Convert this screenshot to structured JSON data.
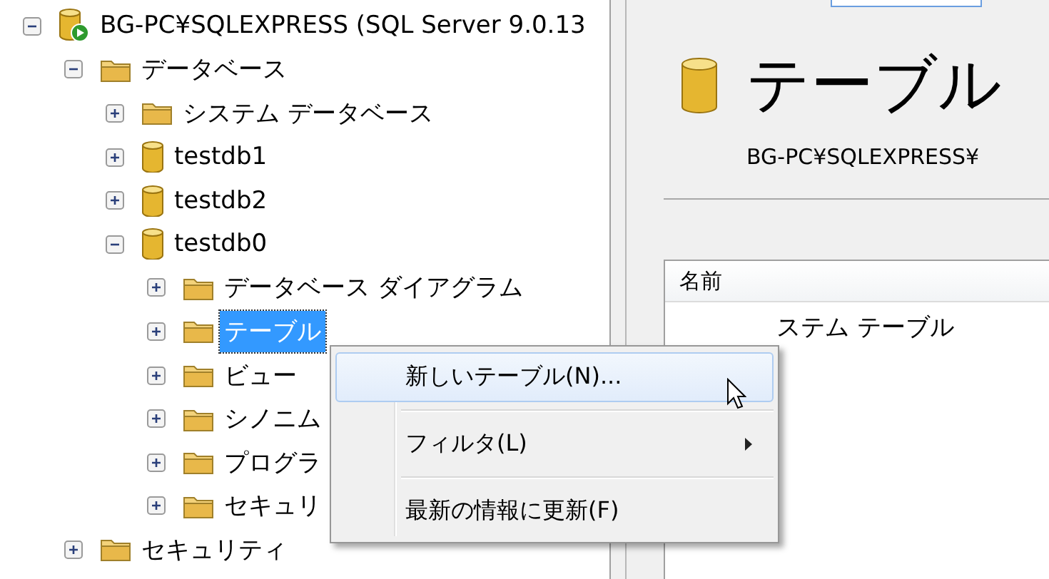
{
  "tree": [
    {
      "label": "BG-PC¥SQLEXPRESS (SQL Server 9.0.13",
      "kind": "server",
      "expanded": true,
      "selected": false,
      "children": [
        {
          "label": "データベース",
          "kind": "folder",
          "expanded": true,
          "selected": false,
          "children": [
            {
              "label": "システム データベース",
              "kind": "folder",
              "expanded": false,
              "selected": false
            },
            {
              "label": "testdb1",
              "kind": "database",
              "expanded": false,
              "selected": false
            },
            {
              "label": "testdb2",
              "kind": "database",
              "expanded": false,
              "selected": false
            },
            {
              "label": "testdb0",
              "kind": "database",
              "expanded": true,
              "selected": false,
              "children": [
                {
                  "label": "データベース ダイアグラム",
                  "kind": "folder",
                  "expanded": false,
                  "selected": false
                },
                {
                  "label": "テーブル",
                  "kind": "folder",
                  "expanded": false,
                  "selected": true
                },
                {
                  "label": "ビュー",
                  "kind": "folder",
                  "expanded": false,
                  "selected": false
                },
                {
                  "label": "シノニム",
                  "kind": "folder",
                  "expanded": false,
                  "selected": false
                },
                {
                  "label": "プログラ",
                  "kind": "folder",
                  "expanded": false,
                  "selected": false
                },
                {
                  "label": "セキュリ",
                  "kind": "folder",
                  "expanded": false,
                  "selected": false
                }
              ]
            }
          ]
        },
        {
          "label": "セキュリティ",
          "kind": "folder",
          "expanded": false,
          "selected": false
        }
      ]
    }
  ],
  "detail": {
    "title": "テーブル",
    "path": "BG-PC¥SQLEXPRESS¥",
    "list": {
      "columns": [
        "名前"
      ],
      "rows": [
        "ステム テーブル"
      ]
    }
  },
  "context_menu": [
    {
      "kind": "item",
      "label": "新しいテーブル(N)...",
      "selected": true,
      "submenu": false
    },
    {
      "kind": "separator"
    },
    {
      "kind": "item",
      "label": "フィルタ(L)",
      "selected": false,
      "submenu": true
    },
    {
      "kind": "separator"
    },
    {
      "kind": "item",
      "label": "最新の情報に更新(F)",
      "selected": false,
      "submenu": false
    }
  ]
}
